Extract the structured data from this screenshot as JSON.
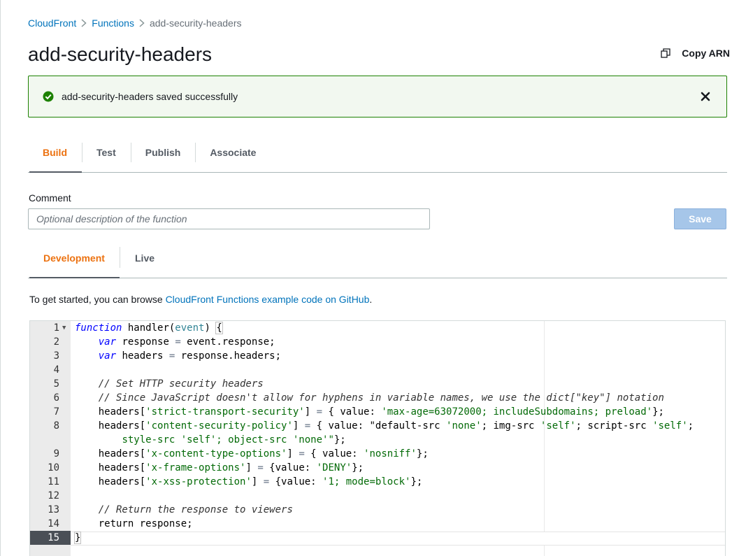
{
  "breadcrumb": {
    "items": [
      "CloudFront",
      "Functions"
    ],
    "current": "add-security-headers"
  },
  "header": {
    "title": "add-security-headers",
    "copy_arn_label": "Copy ARN"
  },
  "flash": {
    "message": "add-security-headers saved successfully",
    "status_color": "#1d8102"
  },
  "tabs": [
    {
      "label": "Build",
      "active": true
    },
    {
      "label": "Test",
      "active": false
    },
    {
      "label": "Publish",
      "active": false
    },
    {
      "label": "Associate",
      "active": false
    }
  ],
  "comment": {
    "label": "Comment",
    "placeholder": "Optional description of the function",
    "value": ""
  },
  "save_label": "Save",
  "subtabs": [
    {
      "label": "Development",
      "active": true
    },
    {
      "label": "Live",
      "active": false
    }
  ],
  "intro": {
    "text": "To get started, you can browse ",
    "link": "CloudFront Functions example code on GitHub",
    "suffix": "."
  },
  "editor": {
    "line_numbers": [
      "1",
      "2",
      "3",
      "4",
      "5",
      "6",
      "7",
      "8",
      "",
      "9",
      "10",
      "11",
      "12",
      "13",
      "14",
      "15"
    ],
    "active_line": "15",
    "code_lines": [
      "function handler(event) {",
      "    var response = event.response;",
      "    var headers = response.headers;",
      "",
      "    // Set HTTP security headers",
      "    // Since JavaScript doesn't allow for hyphens in variable names, we use the dict[\"key\"] notation",
      "    headers['strict-transport-security'] = { value: 'max-age=63072000; includeSubdomains; preload'};",
      "    headers['content-security-policy'] = { value: \"default-src 'none'; img-src 'self'; script-src 'self';",
      "        style-src 'self'; object-src 'none'\"};",
      "    headers['x-content-type-options'] = { value: 'nosniff'};",
      "    headers['x-frame-options'] = {value: 'DENY'};",
      "    headers['x-xss-protection'] = {value: '1; mode=block'};",
      "",
      "    // Return the response to viewers",
      "    return response;",
      "}"
    ]
  },
  "colors": {
    "link": "#0073bb",
    "accent": "#ec7211",
    "success": "#1d8102",
    "save_disabled": "#a6c6e9"
  }
}
